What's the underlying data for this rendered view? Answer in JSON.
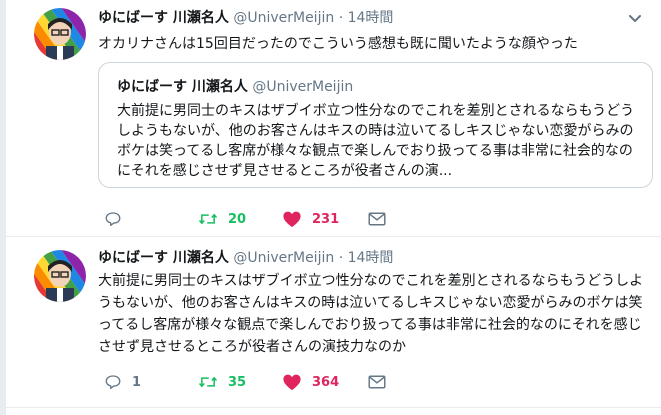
{
  "tweets": [
    {
      "author_name": "ゆにばーす 川瀬名人",
      "handle": "@UniverMeijin",
      "time": "14時間",
      "text": "オカリナさんは15回目だったのでこういう感想も既に聞いたような顔やった",
      "quote": {
        "author_name": "ゆにばーす 川瀬名人",
        "handle": "@UniverMeijin",
        "text": "大前提に男同士のキスはザブイボ立つ性分なのでこれを差別とされるならもうどうしようもないが、他のお客さんはキスの時は泣いてるしキスじゃない恋愛がらみのボケは笑ってるし客席が様々な観点で楽しんでおり扱ってる事は非常に社会的なのにそれを感じさせず見させるところが役者さんの演..."
      },
      "reply_count": "",
      "retweet_count": "20",
      "like_count": "231"
    },
    {
      "author_name": "ゆにばーす 川瀬名人",
      "handle": "@UniverMeijin",
      "time": "14時間",
      "text": "大前提に男同士のキスはザブイボ立つ性分なのでこれを差別とされるならもうどうしようもないが、他のお客さんはキスの時は泣いてるしキスじゃない恋愛がらみのボケは笑ってるし客席が様々な観点で楽しんでおり扱ってる事は非常に社会的なのにそれを感じさせず見させるところが役者さんの演技力なのか",
      "reply_count": "1",
      "retweet_count": "35",
      "like_count": "364"
    }
  ],
  "separator": "·",
  "icons": {
    "reply": "reply-icon",
    "retweet": "retweet-icon",
    "like": "heart-icon",
    "dm": "envelope-icon",
    "menu": "chevron-down-icon"
  },
  "colors": {
    "retweet": "#17bf63",
    "like": "#e0245e",
    "muted": "#657786"
  }
}
